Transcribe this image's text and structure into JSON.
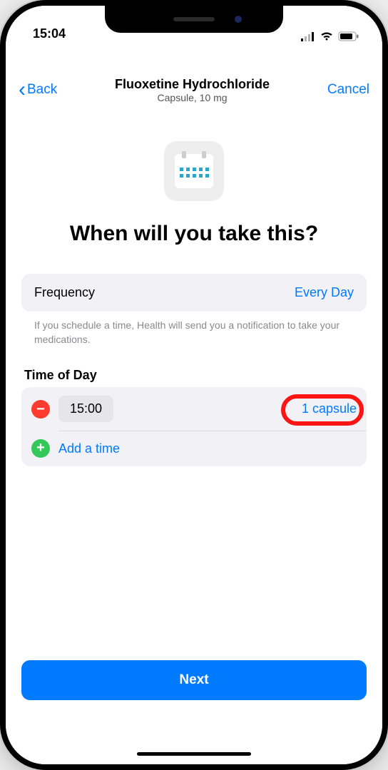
{
  "status": {
    "time": "15:04"
  },
  "nav": {
    "back": "Back",
    "title": "Fluoxetine Hydrochloride",
    "subtitle": "Capsule, 10 mg",
    "cancel": "Cancel"
  },
  "headline": "When will you take this?",
  "frequency": {
    "label": "Frequency",
    "value": "Every Day"
  },
  "hint": "If you schedule a time, Health will send you a notification to take your medications.",
  "timeSection": {
    "label": "Time of Day",
    "rows": [
      {
        "time": "15:00",
        "dose": "1 capsule"
      }
    ],
    "addLabel": "Add a time"
  },
  "nextLabel": "Next"
}
